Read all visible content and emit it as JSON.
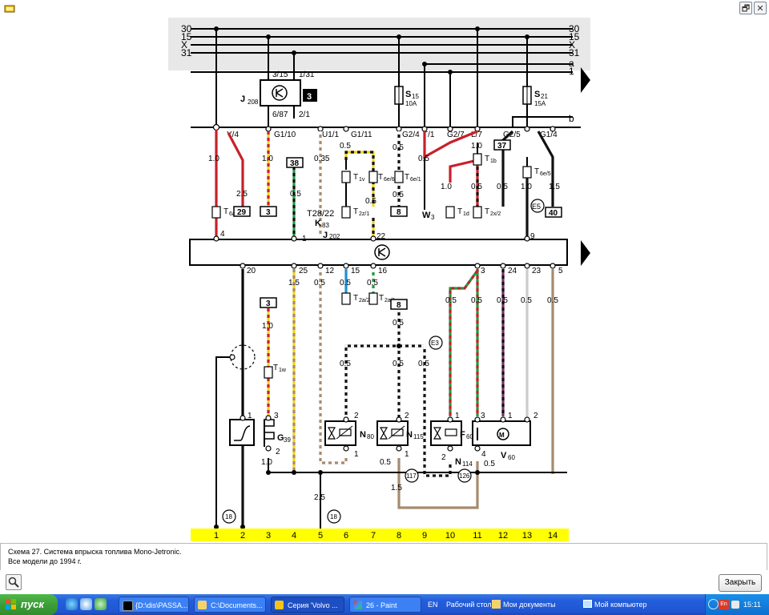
{
  "window": {
    "restore_glyph": "🗗",
    "close_glyph": "✕"
  },
  "diagram": {
    "top_bus": [
      "30",
      "15",
      "X",
      "31"
    ],
    "right_bus_letters": [
      "a",
      "1",
      "b"
    ],
    "relay": {
      "label": "J",
      "sub": "208",
      "badge": "3",
      "pins_top": [
        "3/15",
        "1/31"
      ],
      "pins_bottom": [
        "6/87",
        "2/1"
      ]
    },
    "fuses": [
      {
        "label": "S",
        "sub": "15",
        "rating": "10A"
      },
      {
        "label": "S",
        "sub": "21",
        "rating": "15A"
      }
    ],
    "connectors_top": [
      "Y/4",
      "G1/10",
      "U1/1",
      "G1/11",
      "G2/4",
      "T/1",
      "G2/7",
      "L/7",
      "G2/5",
      "G1/4"
    ],
    "wire_sizes_upper": [
      "1.0",
      "2.5",
      "1.0",
      "0.35",
      "0.5",
      "0.5",
      "0.5",
      "0.5",
      "1.0",
      "0.5",
      "1.0",
      "0.5",
      "0.5",
      "1.0",
      "1.5",
      "0.5"
    ],
    "terminals_upper": [
      "T",
      "6a/2",
      "T",
      "1v",
      "T",
      "6e/6",
      "T",
      "6e/1",
      "T",
      "2z/1",
      "T",
      "1d",
      "T",
      "2x/2",
      "T",
      "1b",
      "T",
      "6e/5"
    ],
    "boxes_upper": [
      "29",
      "3",
      "38",
      "8",
      "37",
      "40"
    ],
    "labels_upper": [
      "T28/22",
      "K",
      "83",
      "W",
      "3",
      "E5"
    ],
    "ecu": {
      "label": "J",
      "sub": "202",
      "pins_top": [
        "4",
        "1",
        "22",
        "9"
      ],
      "pins_bottom": [
        "20",
        "25",
        "12",
        "15",
        "16",
        "3",
        "24",
        "23",
        "5"
      ]
    },
    "wire_sizes_lower": [
      "1.5",
      "0.5",
      "0.5",
      "0.5",
      "0.5",
      "0.5",
      "0.5",
      "0.5",
      "0.5",
      "0.5",
      "0.5",
      "0.5",
      "1.0",
      "0.5",
      "1.0",
      "0.5",
      "0.5",
      "1.5",
      "2.5"
    ],
    "terminals_lower": [
      "T",
      "2a/2",
      "T",
      "2a/1",
      "T",
      "1w"
    ],
    "boxes_lower": [
      "3",
      "8"
    ],
    "components": [
      {
        "label": "G",
        "sub": "39",
        "pins": [
          "1",
          "3",
          "2"
        ]
      },
      {
        "label": "N",
        "sub": "80",
        "pins": [
          "2",
          "1"
        ]
      },
      {
        "label": "N",
        "sub": "115",
        "pins": [
          "2",
          "1"
        ]
      },
      {
        "label": "F",
        "sub": "60",
        "pins": [
          "1",
          "2"
        ]
      },
      {
        "label": "N",
        "sub": "114",
        "pins": []
      },
      {
        "label": "V",
        "sub": "60",
        "pins": [
          "3",
          "4",
          "1",
          "2"
        ]
      }
    ],
    "circles": [
      "18",
      "18",
      "117",
      "126",
      "E3"
    ],
    "bottom_numbers": [
      "1",
      "2",
      "3",
      "4",
      "5",
      "6",
      "7",
      "8",
      "9",
      "10",
      "11",
      "12",
      "13",
      "14"
    ],
    "colors": {
      "red": "#c8202a",
      "yellow": "#f2d21a",
      "green": "#1e9a3e",
      "brown": "#a58b6e",
      "black": "#111111",
      "purple": "#7b2d6b",
      "blue": "#1f8fd6",
      "bus_bg": "#e8e8e8",
      "strip": "#ffff00"
    }
  },
  "caption": {
    "line1": "Схема 27. Система впрыска топлива Mono-Jetronic.",
    "line2": "Все модели до 1994 г."
  },
  "toolbar": {
    "search_icon": "magnifier-icon",
    "close_label": "Закрыть"
  },
  "taskbar": {
    "start_label": "пуск",
    "tasks": [
      {
        "label": "{D:\\dis\\PASSA...",
        "icon": "console-icon"
      },
      {
        "label": "C:\\Documents...",
        "icon": "folder-icon"
      },
      {
        "label": "Серия 'Volvo ...",
        "icon": "book-icon"
      },
      {
        "label": "26 - Paint",
        "icon": "paint-icon"
      }
    ],
    "lang": "EN",
    "desktop": "Рабочий стол",
    "my_docs": "Мои документы",
    "my_computer": "Мой компьютер",
    "tray_lang": "En",
    "clock": "15:11"
  }
}
